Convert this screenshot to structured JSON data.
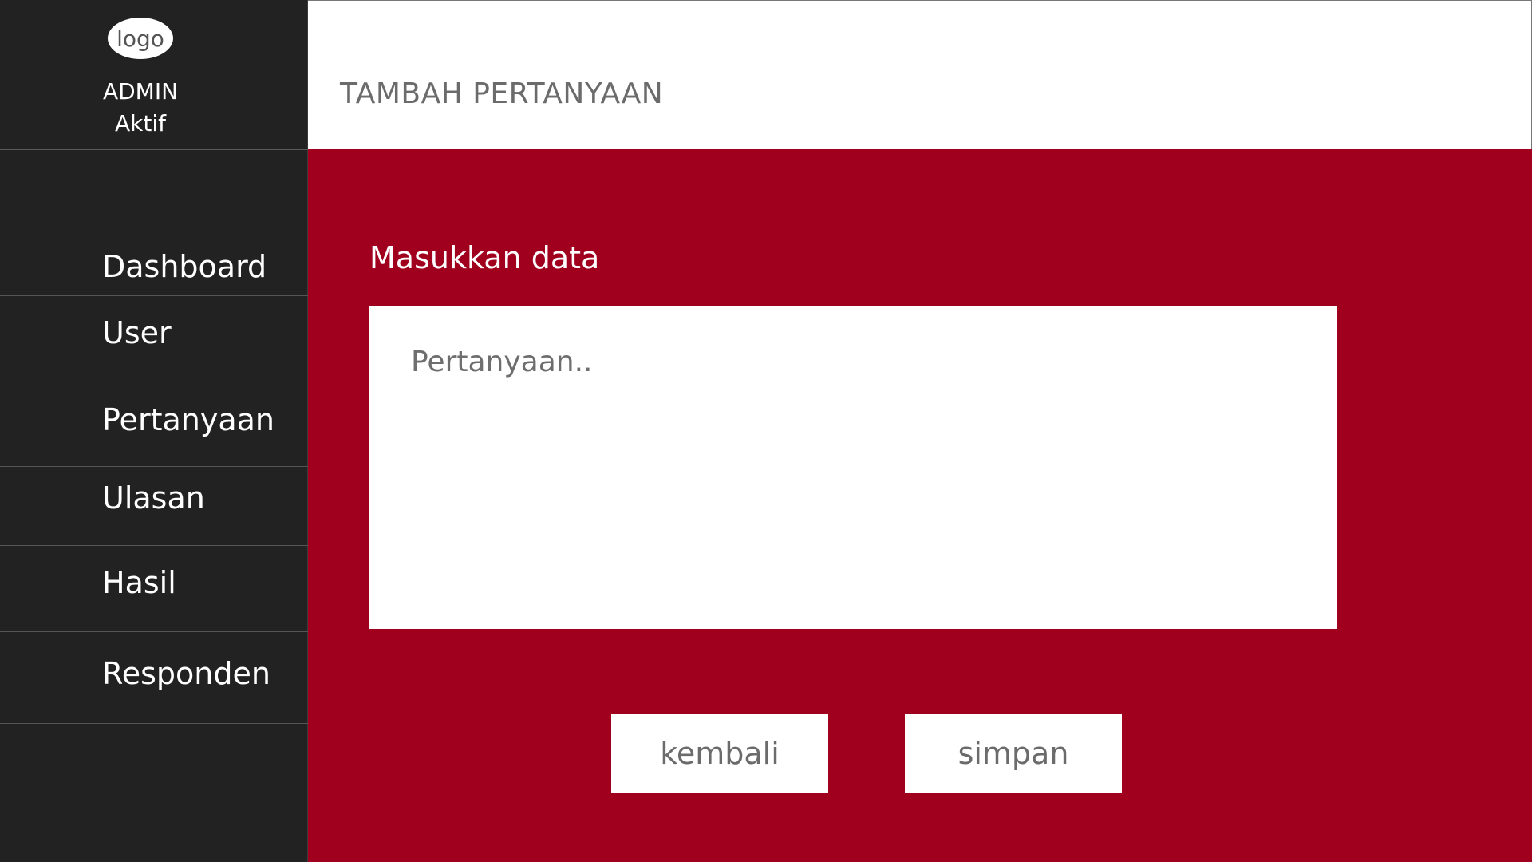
{
  "sidebar": {
    "logo_text": "logo",
    "user_name": "ADMIN",
    "user_status": "Aktif",
    "items": [
      {
        "label": "Dashboard"
      },
      {
        "label": "User"
      },
      {
        "label": "Pertanyaan"
      },
      {
        "label": "Ulasan"
      },
      {
        "label": "Hasil"
      },
      {
        "label": "Responden"
      }
    ]
  },
  "header": {
    "title": "TAMBAH PERTANYAAN"
  },
  "form": {
    "label": "Masukkan data",
    "question_value": "",
    "question_placeholder": "Pertanyaan..",
    "back_label": "kembali",
    "save_label": "simpan"
  },
  "colors": {
    "sidebar_bg": "#222222",
    "main_bg": "#a0001e",
    "header_bg": "#ffffff"
  }
}
